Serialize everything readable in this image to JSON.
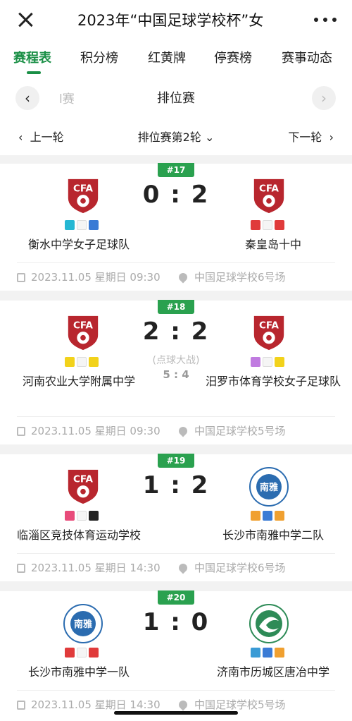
{
  "topbar": {
    "title": "2023年“中国足球学校杯”女",
    "close_icon": "close-icon",
    "more_icon": "more-icon"
  },
  "tabs": [
    {
      "label": "赛程表",
      "active": true
    },
    {
      "label": "积分榜",
      "active": false
    },
    {
      "label": "红黄牌",
      "active": false
    },
    {
      "label": "停赛榜",
      "active": false
    },
    {
      "label": "赛事动态",
      "active": false
    }
  ],
  "stage": {
    "prev_partial": "l赛",
    "name": "排位赛",
    "prev_icon": "‹",
    "next_icon": "›"
  },
  "round": {
    "prev": "上一轮",
    "current": "排位赛第2轮",
    "next": "下一轮"
  },
  "colors": {
    "accent": "#1a8f46",
    "badge": "#2aa14f",
    "cfa_red": "#b8262e"
  },
  "matches": [
    {
      "no": "#17",
      "score": "0 : 2",
      "home": {
        "name": "衡水中学女子足球队",
        "crest": "cfa-crest"
      },
      "away": {
        "name": "秦皇岛十中",
        "crest": "cfa-crest"
      },
      "datetime": "2023.11.05 星期日 09:30",
      "venue": "中国足球学校6号场"
    },
    {
      "no": "#18",
      "score": "2 : 2",
      "penalty_label": "(点球大战)",
      "penalty_score": "5 : 4",
      "home": {
        "name": "河南农业大学附属中学",
        "crest": "cfa-crest"
      },
      "away": {
        "name": "汨罗市体育学校女子足球队",
        "crest": "cfa-crest"
      },
      "datetime": "2023.11.05 星期日 09:30",
      "venue": "中国足球学校5号场"
    },
    {
      "no": "#19",
      "score": "1 : 2",
      "home": {
        "name": "临淄区竞技体育运动学校",
        "crest": "cfa-crest"
      },
      "away": {
        "name": "长沙市南雅中学二队",
        "crest": "nanya-crest"
      },
      "datetime": "2023.11.05 星期日 14:30",
      "venue": "中国足球学校6号场"
    },
    {
      "no": "#20",
      "score": "1 : 0",
      "home": {
        "name": "长沙市南雅中学一队",
        "crest": "nanya-crest"
      },
      "away": {
        "name": "济南市历城区唐冶中学",
        "crest": "tangye-crest"
      },
      "datetime": "2023.11.05 星期日 14:30",
      "venue": "中国足球学校5号场"
    }
  ]
}
